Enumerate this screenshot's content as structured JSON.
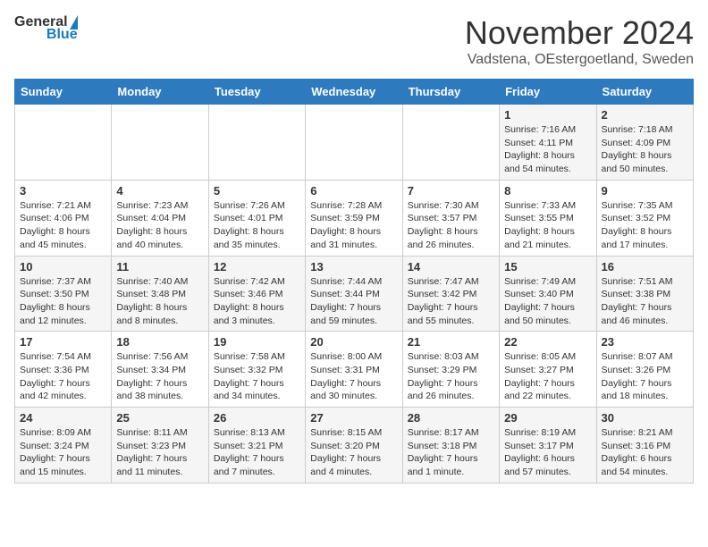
{
  "header": {
    "logo_general": "General",
    "logo_blue": "Blue",
    "title": "November 2024",
    "location": "Vadstena, OEstergoetland, Sweden"
  },
  "weekdays": [
    "Sunday",
    "Monday",
    "Tuesday",
    "Wednesday",
    "Thursday",
    "Friday",
    "Saturday"
  ],
  "weeks": [
    [
      {
        "day": "",
        "info": ""
      },
      {
        "day": "",
        "info": ""
      },
      {
        "day": "",
        "info": ""
      },
      {
        "day": "",
        "info": ""
      },
      {
        "day": "",
        "info": ""
      },
      {
        "day": "1",
        "info": "Sunrise: 7:16 AM\nSunset: 4:11 PM\nDaylight: 8 hours and 54 minutes."
      },
      {
        "day": "2",
        "info": "Sunrise: 7:18 AM\nSunset: 4:09 PM\nDaylight: 8 hours and 50 minutes."
      }
    ],
    [
      {
        "day": "3",
        "info": "Sunrise: 7:21 AM\nSunset: 4:06 PM\nDaylight: 8 hours and 45 minutes."
      },
      {
        "day": "4",
        "info": "Sunrise: 7:23 AM\nSunset: 4:04 PM\nDaylight: 8 hours and 40 minutes."
      },
      {
        "day": "5",
        "info": "Sunrise: 7:26 AM\nSunset: 4:01 PM\nDaylight: 8 hours and 35 minutes."
      },
      {
        "day": "6",
        "info": "Sunrise: 7:28 AM\nSunset: 3:59 PM\nDaylight: 8 hours and 31 minutes."
      },
      {
        "day": "7",
        "info": "Sunrise: 7:30 AM\nSunset: 3:57 PM\nDaylight: 8 hours and 26 minutes."
      },
      {
        "day": "8",
        "info": "Sunrise: 7:33 AM\nSunset: 3:55 PM\nDaylight: 8 hours and 21 minutes."
      },
      {
        "day": "9",
        "info": "Sunrise: 7:35 AM\nSunset: 3:52 PM\nDaylight: 8 hours and 17 minutes."
      }
    ],
    [
      {
        "day": "10",
        "info": "Sunrise: 7:37 AM\nSunset: 3:50 PM\nDaylight: 8 hours and 12 minutes."
      },
      {
        "day": "11",
        "info": "Sunrise: 7:40 AM\nSunset: 3:48 PM\nDaylight: 8 hours and 8 minutes."
      },
      {
        "day": "12",
        "info": "Sunrise: 7:42 AM\nSunset: 3:46 PM\nDaylight: 8 hours and 3 minutes."
      },
      {
        "day": "13",
        "info": "Sunrise: 7:44 AM\nSunset: 3:44 PM\nDaylight: 7 hours and 59 minutes."
      },
      {
        "day": "14",
        "info": "Sunrise: 7:47 AM\nSunset: 3:42 PM\nDaylight: 7 hours and 55 minutes."
      },
      {
        "day": "15",
        "info": "Sunrise: 7:49 AM\nSunset: 3:40 PM\nDaylight: 7 hours and 50 minutes."
      },
      {
        "day": "16",
        "info": "Sunrise: 7:51 AM\nSunset: 3:38 PM\nDaylight: 7 hours and 46 minutes."
      }
    ],
    [
      {
        "day": "17",
        "info": "Sunrise: 7:54 AM\nSunset: 3:36 PM\nDaylight: 7 hours and 42 minutes."
      },
      {
        "day": "18",
        "info": "Sunrise: 7:56 AM\nSunset: 3:34 PM\nDaylight: 7 hours and 38 minutes."
      },
      {
        "day": "19",
        "info": "Sunrise: 7:58 AM\nSunset: 3:32 PM\nDaylight: 7 hours and 34 minutes."
      },
      {
        "day": "20",
        "info": "Sunrise: 8:00 AM\nSunset: 3:31 PM\nDaylight: 7 hours and 30 minutes."
      },
      {
        "day": "21",
        "info": "Sunrise: 8:03 AM\nSunset: 3:29 PM\nDaylight: 7 hours and 26 minutes."
      },
      {
        "day": "22",
        "info": "Sunrise: 8:05 AM\nSunset: 3:27 PM\nDaylight: 7 hours and 22 minutes."
      },
      {
        "day": "23",
        "info": "Sunrise: 8:07 AM\nSunset: 3:26 PM\nDaylight: 7 hours and 18 minutes."
      }
    ],
    [
      {
        "day": "24",
        "info": "Sunrise: 8:09 AM\nSunset: 3:24 PM\nDaylight: 7 hours and 15 minutes."
      },
      {
        "day": "25",
        "info": "Sunrise: 8:11 AM\nSunset: 3:23 PM\nDaylight: 7 hours and 11 minutes."
      },
      {
        "day": "26",
        "info": "Sunrise: 8:13 AM\nSunset: 3:21 PM\nDaylight: 7 hours and 7 minutes."
      },
      {
        "day": "27",
        "info": "Sunrise: 8:15 AM\nSunset: 3:20 PM\nDaylight: 7 hours and 4 minutes."
      },
      {
        "day": "28",
        "info": "Sunrise: 8:17 AM\nSunset: 3:18 PM\nDaylight: 7 hours and 1 minute."
      },
      {
        "day": "29",
        "info": "Sunrise: 8:19 AM\nSunset: 3:17 PM\nDaylight: 6 hours and 57 minutes."
      },
      {
        "day": "30",
        "info": "Sunrise: 8:21 AM\nSunset: 3:16 PM\nDaylight: 6 hours and 54 minutes."
      }
    ]
  ]
}
